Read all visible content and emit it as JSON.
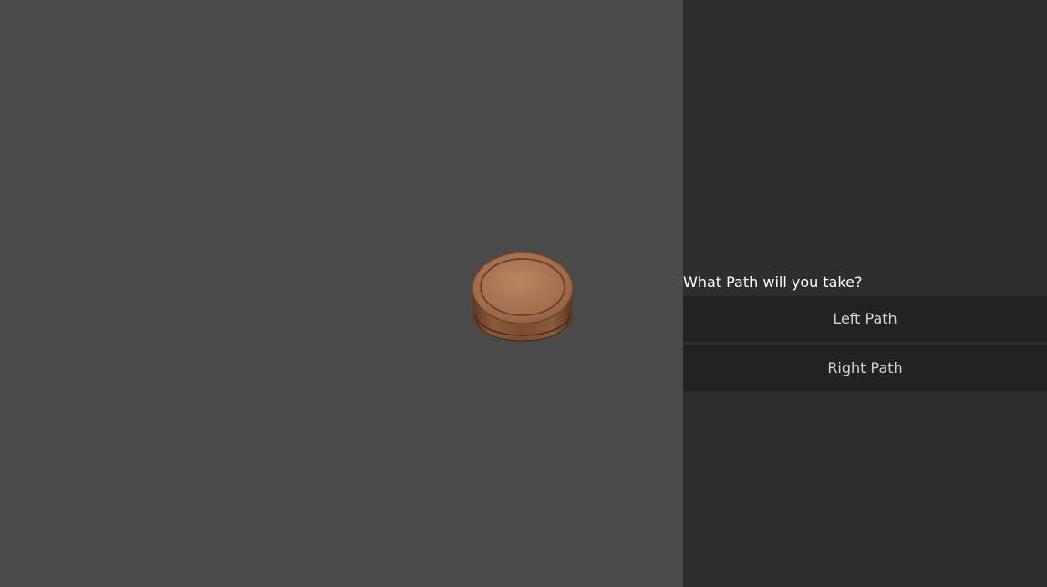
{
  "scene": {
    "piece_icon": "wooden-token-icon",
    "piece_color": "#9a6646"
  },
  "panel": {
    "prompt": "What Path will you take?",
    "choices": [
      {
        "label": "Left Path"
      },
      {
        "label": "Right Path"
      }
    ]
  },
  "colors": {
    "viewport_bg": "#4a4a4a",
    "panel_bg": "#2d2d2d",
    "button_bg": "#222222",
    "button_text": "#d4d4d4"
  }
}
